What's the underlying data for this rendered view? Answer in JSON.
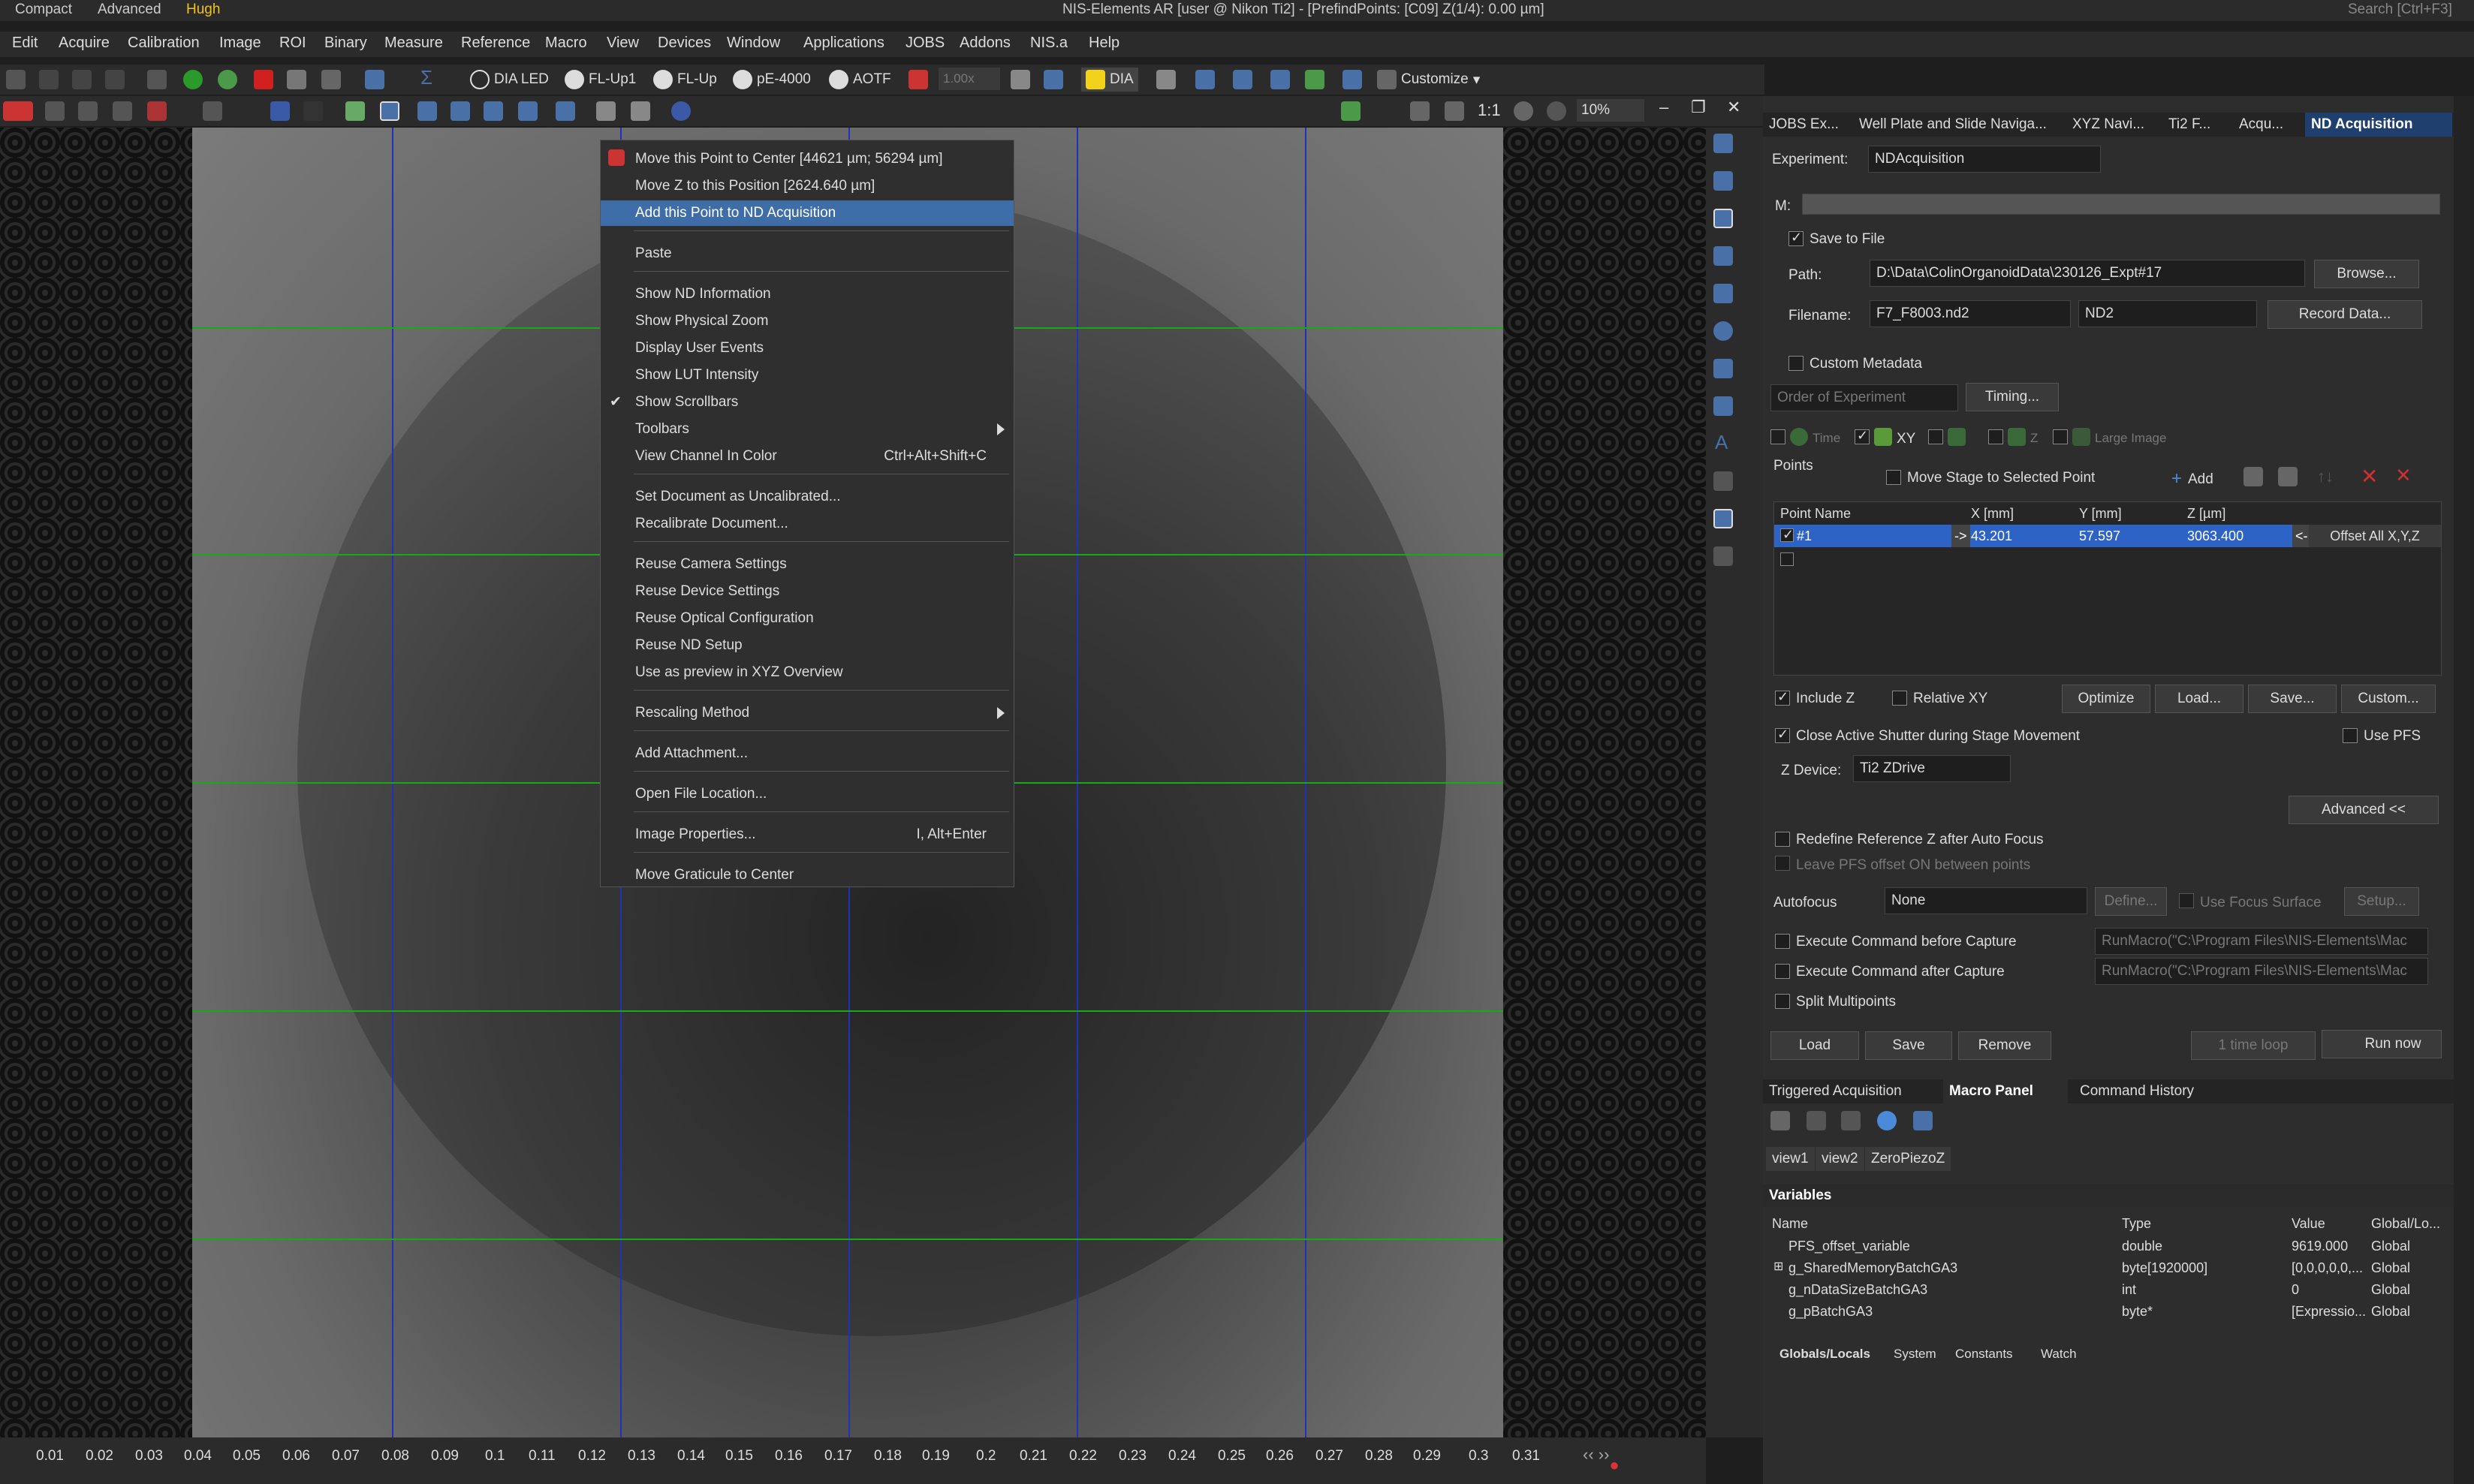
{
  "titlebar": {
    "modes": [
      "Compact",
      "Advanced",
      "Hugh"
    ],
    "active_mode": "Hugh",
    "title": "NIS-Elements AR [user @ Nikon Ti2]  - [PrefindPoints: [C09]  Z(1/4): 0.00 µm]",
    "search_placeholder": "Search [Ctrl+F3]"
  },
  "menubar": [
    "Edit",
    "Acquire",
    "Calibration",
    "Image",
    "ROI",
    "Binary",
    "Measure",
    "Reference",
    "Macro",
    "View",
    "Devices",
    "Window",
    "Applications",
    "JOBS",
    "Addons",
    "NIS.a",
    "Help"
  ],
  "toolbar1": {
    "dia_led": "DIA LED",
    "fl_up1": "FL-Up1",
    "fl_up": "FL-Up",
    "pe4000": "pE-4000",
    "aotf": "AOTF",
    "power_value": "1.00x",
    "dia": "DIA",
    "customize": "Customize"
  },
  "toolbar2": {
    "zoom_ratio": "1:1",
    "zoom_value": "10%"
  },
  "context_menu": {
    "items": [
      {
        "label": "Move this Point to Center [44621 µm; 56294 µm]"
      },
      {
        "label": "Move Z to this Position [2624.640 µm]"
      },
      {
        "label": "Add this Point to ND Acquisition",
        "highlighted": true
      },
      {
        "label": "Paste"
      },
      {
        "label": "Show ND Information"
      },
      {
        "label": "Show Physical Zoom"
      },
      {
        "label": "Display User Events"
      },
      {
        "label": "Show LUT Intensity"
      },
      {
        "label": "Show Scrollbars",
        "checked": true
      },
      {
        "label": "Toolbars",
        "submenu": true
      },
      {
        "label": "View Channel In Color",
        "shortcut": "Ctrl+Alt+Shift+C"
      },
      {
        "label": "Set Document as Uncalibrated..."
      },
      {
        "label": "Recalibrate Document..."
      },
      {
        "label": "Reuse Camera Settings"
      },
      {
        "label": "Reuse Device Settings"
      },
      {
        "label": "Reuse Optical Configuration"
      },
      {
        "label": "Reuse ND Setup"
      },
      {
        "label": "Use as preview in XYZ Overview"
      },
      {
        "label": "Rescaling Method",
        "submenu": true
      },
      {
        "label": "Add Attachment..."
      },
      {
        "label": "Open File Location..."
      },
      {
        "label": "Image Properties...",
        "shortcut": "I, Alt+Enter"
      },
      {
        "label": "Move Graticule to Center"
      }
    ]
  },
  "ruler": {
    "ticks": [
      "0.01",
      "0.02",
      "0.03",
      "0.04",
      "0.05",
      "0.06",
      "0.07",
      "0.08",
      "0.09",
      "0.1",
      "0.11",
      "0.12",
      "0.13",
      "0.14",
      "0.15",
      "0.16",
      "0.17",
      "0.18",
      "0.19",
      "0.2",
      "0.21",
      "0.22",
      "0.23",
      "0.24",
      "0.25",
      "0.26",
      "0.27",
      "0.28",
      "0.29",
      "0.3",
      "0.31"
    ]
  },
  "panel_tabs": [
    "JOBS Ex...",
    "Well Plate and Slide Naviga...",
    "XYZ Navi...",
    "Ti2 F...",
    "Acqu...",
    "ND Acquisition"
  ],
  "nd": {
    "experiment_label": "Experiment:",
    "experiment_value": "NDAcquisition",
    "m_label": "M:",
    "save_to_file": "Save to File",
    "path_label": "Path:",
    "path_value": "D:\\Data\\ColinOrganoidData\\230126_Expt#17",
    "browse": "Browse...",
    "filename_label": "Filename:",
    "filename_value": "F7_F8003.nd2",
    "format_value": "ND2",
    "record_data": "Record Data...",
    "custom_metadata": "Custom Metadata",
    "order_of_experiment": "Order of Experiment",
    "timing": "Timing...",
    "dim_time": "Time",
    "dim_xy": "XY",
    "dim_z": "Z",
    "dim_large_image": "Large Image",
    "points_label": "Points",
    "move_stage": "Move Stage to Selected Point",
    "add": "Add",
    "columns": [
      "Point Name",
      "X [mm]",
      "Y [mm]",
      "Z [µm]"
    ],
    "point": {
      "name": "#1",
      "x": "43.201",
      "y": "57.597",
      "z": "3063.400"
    },
    "offset_all": "Offset All X,Y,Z",
    "include_z": "Include Z",
    "relative_xy": "Relative XY",
    "optimize": "Optimize",
    "load_dots": "Load...",
    "save_dots": "Save...",
    "custom_dots": "Custom...",
    "close_shutter": "Close Active Shutter during Stage Movement",
    "use_pfs": "Use PFS",
    "z_device_label": "Z Device:",
    "z_device_value": "Ti2 ZDrive",
    "advanced": "Advanced <<",
    "redefine_z": "Redefine Reference Z after Auto Focus",
    "leave_pfs": "Leave PFS offset ON between points",
    "autofocus_label": "Autofocus",
    "autofocus_value": "None",
    "define": "Define...",
    "use_focus_surface": "Use Focus Surface",
    "setup": "Setup...",
    "exec_before": "Execute Command before Capture",
    "exec_before_value": "RunMacro(\"C:\\Program Files\\NIS-Elements\\Mac",
    "exec_after": "Execute Command after Capture",
    "exec_after_value": "RunMacro(\"C:\\Program Files\\NIS-Elements\\Mac",
    "split_multipoints": "Split Multipoints",
    "load": "Load",
    "save": "Save",
    "remove": "Remove",
    "time_loop": "1 time loop",
    "run_now": "Run now"
  },
  "bottom_tabs": [
    "Triggered Acquisition",
    "Macro Panel",
    "Command History"
  ],
  "macro_views": [
    "view1",
    "view2",
    "ZeroPiezoZ"
  ],
  "variables": {
    "title": "Variables",
    "columns": [
      "Name",
      "Type",
      "Value",
      "Global/Lo..."
    ],
    "rows": [
      {
        "name": "PFS_offset_variable",
        "type": "double",
        "value": "9619.000",
        "scope": "Global"
      },
      {
        "name": "g_SharedMemoryBatchGA3",
        "type": "byte[1920000]",
        "value": "[0,0,0,0,0,...",
        "scope": "Global"
      },
      {
        "name": "g_nDataSizeBatchGA3",
        "type": "int",
        "value": "0",
        "scope": "Global"
      },
      {
        "name": "g_pBatchGA3",
        "type": "byte*",
        "value": "[Expressio...",
        "scope": "Global"
      }
    ],
    "tabs": [
      "Globals/Locals",
      "System",
      "Constants",
      "Watch"
    ]
  },
  "colors": {
    "accent": "#f2c21b",
    "selection": "#2c63c4",
    "menu_highlight": "#3e6da8",
    "grid_vertical": "#2330b8",
    "grid_horizontal": "#1aa81a"
  }
}
